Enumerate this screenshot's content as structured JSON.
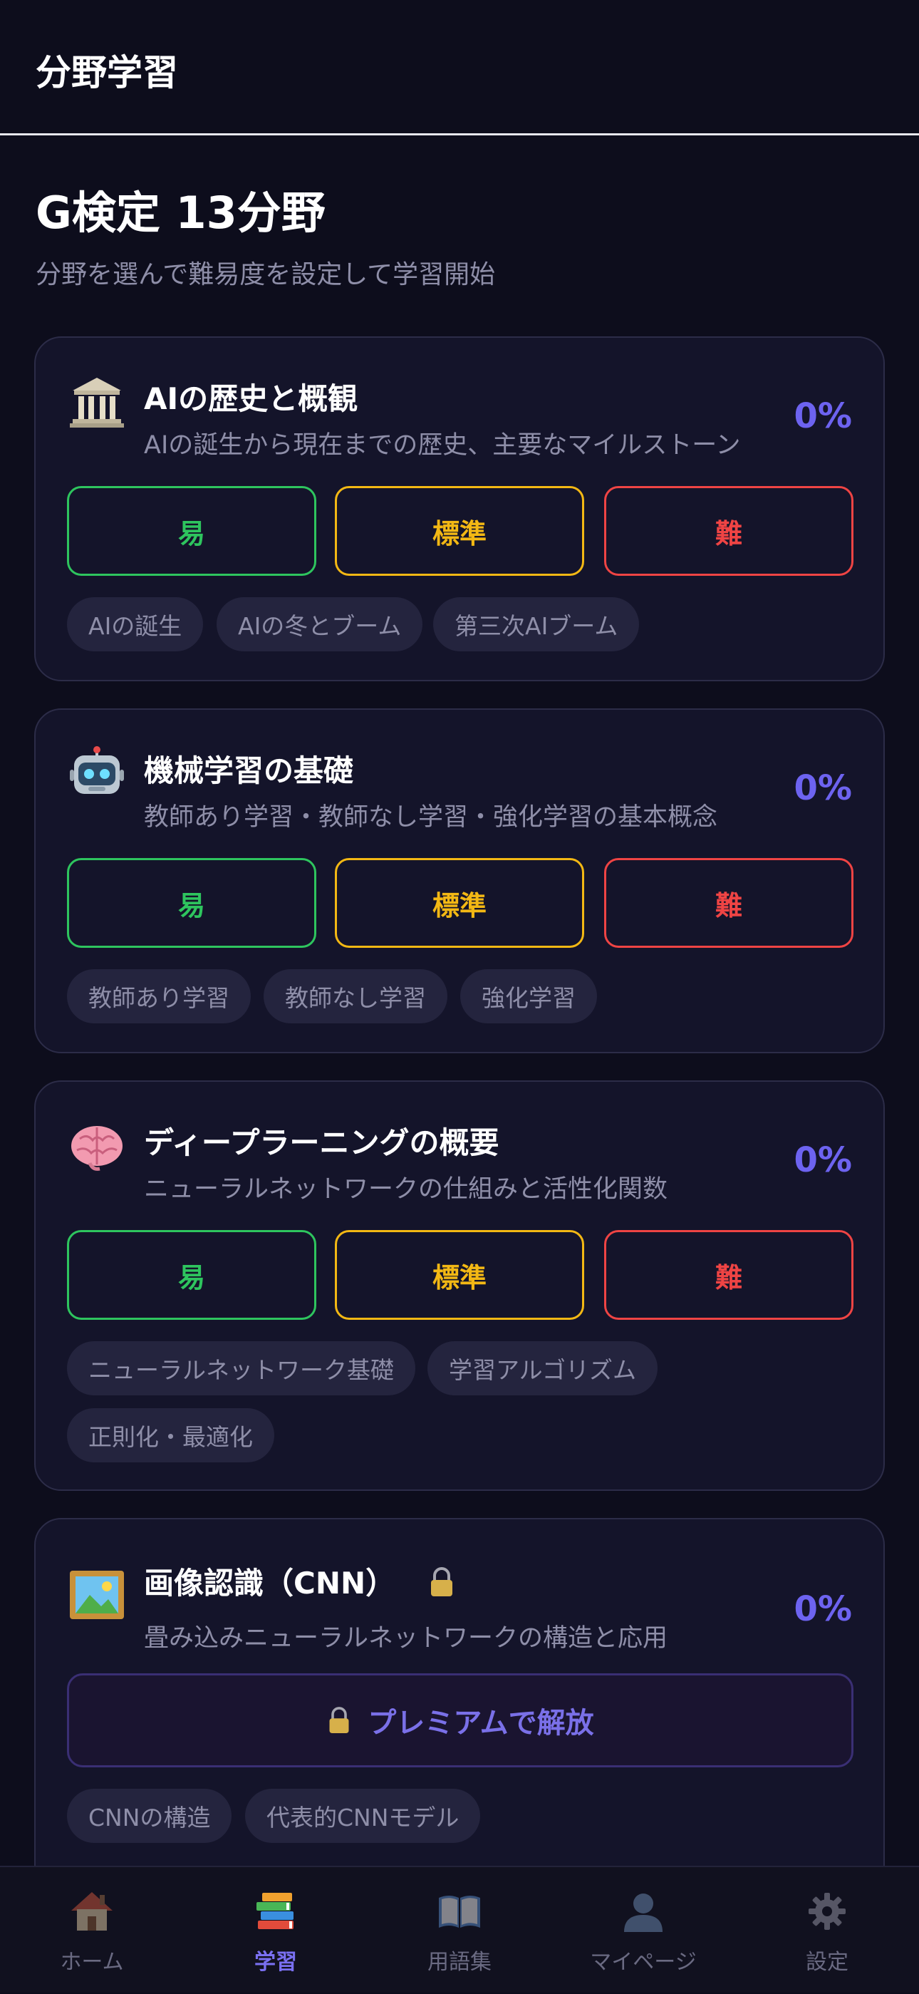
{
  "header": {
    "title": "分野学習"
  },
  "page": {
    "heading": "G検定 13分野",
    "subtitle": "分野を選んで難易度を設定して学習開始"
  },
  "difficulty": {
    "easy": "易",
    "standard": "標準",
    "hard": "難"
  },
  "cards": [
    {
      "icon": "classical-building-icon",
      "title": "AIの歴史と概観",
      "description": "AIの誕生から現在までの歴史、主要なマイルストーン",
      "progress": "0%",
      "tags": [
        "AIの誕生",
        "AIの冬とブーム",
        "第三次AIブーム"
      ]
    },
    {
      "icon": "robot-icon",
      "title": "機械学習の基礎",
      "description": "教師あり学習・教師なし学習・強化学習の基本概念",
      "progress": "0%",
      "tags": [
        "教師あり学習",
        "教師なし学習",
        "強化学習"
      ]
    },
    {
      "icon": "brain-icon",
      "title": "ディープラーニングの概要",
      "description": "ニューラルネットワークの仕組みと活性化関数",
      "progress": "0%",
      "tags": [
        "ニューラルネットワーク基礎",
        "学習アルゴリズム",
        "正則化・最適化"
      ]
    },
    {
      "icon": "framed-picture-icon",
      "title": "画像認識（CNN）",
      "description": "畳み込みニューラルネットワークの構造と応用",
      "progress": "0%",
      "locked": true,
      "premium_label": "プレミアムで解放",
      "tags": [
        "CNNの構造",
        "代表的CNNモデル"
      ]
    }
  ],
  "bottom_nav": [
    {
      "label": "ホーム",
      "icon": "house-icon"
    },
    {
      "label": "学習",
      "icon": "books-icon",
      "active": true
    },
    {
      "label": "用語集",
      "icon": "open-book-icon"
    },
    {
      "label": "マイページ",
      "icon": "user-silhouette-icon"
    },
    {
      "label": "設定",
      "icon": "gear-icon"
    }
  ],
  "colors": {
    "accent": "#6d63f0",
    "easy": "#2ec55e",
    "standard": "#f3b814",
    "hard": "#ef4444"
  }
}
